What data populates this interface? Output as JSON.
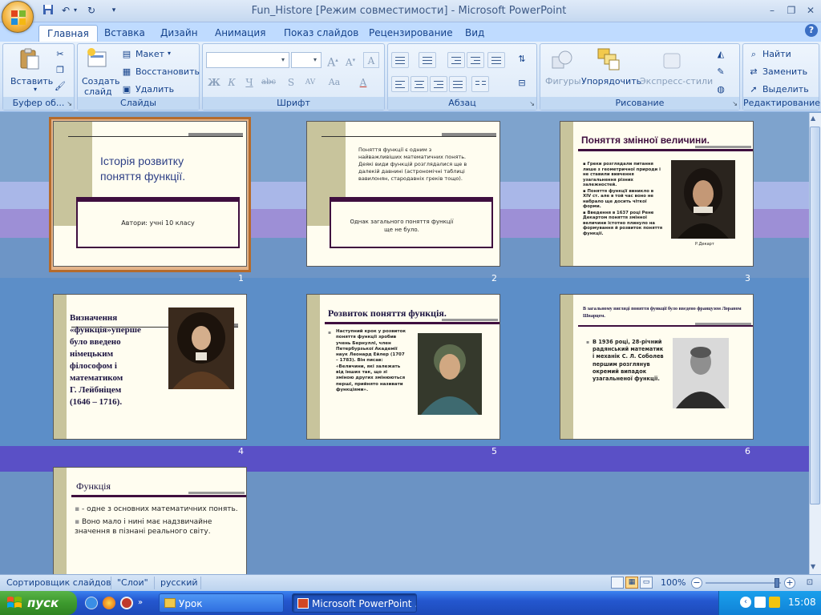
{
  "window": {
    "title": "Fun_Histore [Режим совместимости] - Microsoft PowerPoint",
    "controls": [
      "–",
      "❐",
      "✕"
    ]
  },
  "quick_access": [
    "save-icon",
    "undo-icon",
    "redo-icon",
    "customize-icon"
  ],
  "tabs": [
    {
      "label": "Главная",
      "active": true
    },
    {
      "label": "Вставка"
    },
    {
      "label": "Дизайн"
    },
    {
      "label": "Анимация"
    },
    {
      "label": "Показ слайдов"
    },
    {
      "label": "Рецензирование"
    },
    {
      "label": "Вид"
    }
  ],
  "ribbon": {
    "clipboard": {
      "label": "Буфер об...",
      "paste": "Вставить"
    },
    "slides": {
      "label": "Слайды",
      "new_slide_1": "Создать",
      "new_slide_2": "слайд",
      "layout": "Макет",
      "reset": "Восстановить",
      "delete": "Удалить"
    },
    "font": {
      "label": "Шрифт"
    },
    "paragraph": {
      "label": "Абзац"
    },
    "drawing": {
      "label": "Рисование",
      "shapes": "Фигуры",
      "arrange": "Упорядочить",
      "quick_styles": "Экспресс-стили"
    },
    "editing": {
      "label": "Редактирование",
      "find": "Найти",
      "replace": "Заменить",
      "select": "Выделить"
    }
  },
  "slides": [
    {
      "number": "1",
      "title_1": "Історія розвитку",
      "title_2": "поняття функції.",
      "subtitle": "Автори: учні 10 класу"
    },
    {
      "number": "2",
      "text_1": "Поняття функції є одним з",
      "text_2": "найважливіших математичних понять.",
      "text_3": "Деякі види функцій розглядалися ще в",
      "text_4": "далекій давнині (астрономічні таблиці",
      "text_5": "вавилонян, стародавніх греків тощо).",
      "box_1": "Однак загального поняття функції",
      "box_2": "ще не було."
    },
    {
      "number": "3",
      "title": "Поняття змінної величини.",
      "bullets": [
        "Греки розглядали питання лише з геометричної природи і не ставили вивчення узагальнення різних залежностей.",
        "Поняття функції виникло в XIV ст. але в той час воно не набрало ще досить чіткої форми.",
        "Введення в 1637 році Рене Декартом поняття змінної величини істотно плинуло на формування й розвиток поняття функції."
      ],
      "caption": "Р.Декарт"
    },
    {
      "number": "4",
      "lines": [
        "Визначення",
        "«функція»уперше",
        "було введено",
        "німецьким",
        "філософом і",
        "математиком",
        "Г. Лейбніцем",
        "(1646 – 1716)."
      ]
    },
    {
      "number": "5",
      "title": "Розвиток поняття функція.",
      "body": "Наступний крок у розвиток поняття функції зробив учень Бернуллі, член Петербурзької Академії наук Леонард Ейлер (1707 – 1783). Він писав: «Величини, які залежать від інших так, що зі зміною других змінюються перші, прийнято називати функціями»."
    },
    {
      "number": "6",
      "title": "В загальному вигляді поняття функції було введено французом Лораном Шварцем.",
      "body": "В 1936 році, 28-річний радянський математик і механік С. Л. Соболев першим розглянув окремий випадок узагальненої функції."
    },
    {
      "number": "7",
      "title": "Функція",
      "bullet_1": "- одне з основних математичних понять.",
      "bullet_2": "Воно мало і нині має надзвичайне значення в пізнані реального світу."
    }
  ],
  "status": {
    "view": "Сортировщик слайдов",
    "theme": "\"Слои\"",
    "language": "русский",
    "zoom": "100%"
  },
  "taskbar": {
    "start": "пуск",
    "tasks": [
      {
        "label": "Урок"
      },
      {
        "label": "Microsoft PowerPoint ..."
      }
    ],
    "lang": "EN",
    "time": "15:08"
  },
  "colors": {
    "accent": "#3f0f3f",
    "ribbon": "#dbe8f7",
    "selection": "#b56b2c"
  }
}
